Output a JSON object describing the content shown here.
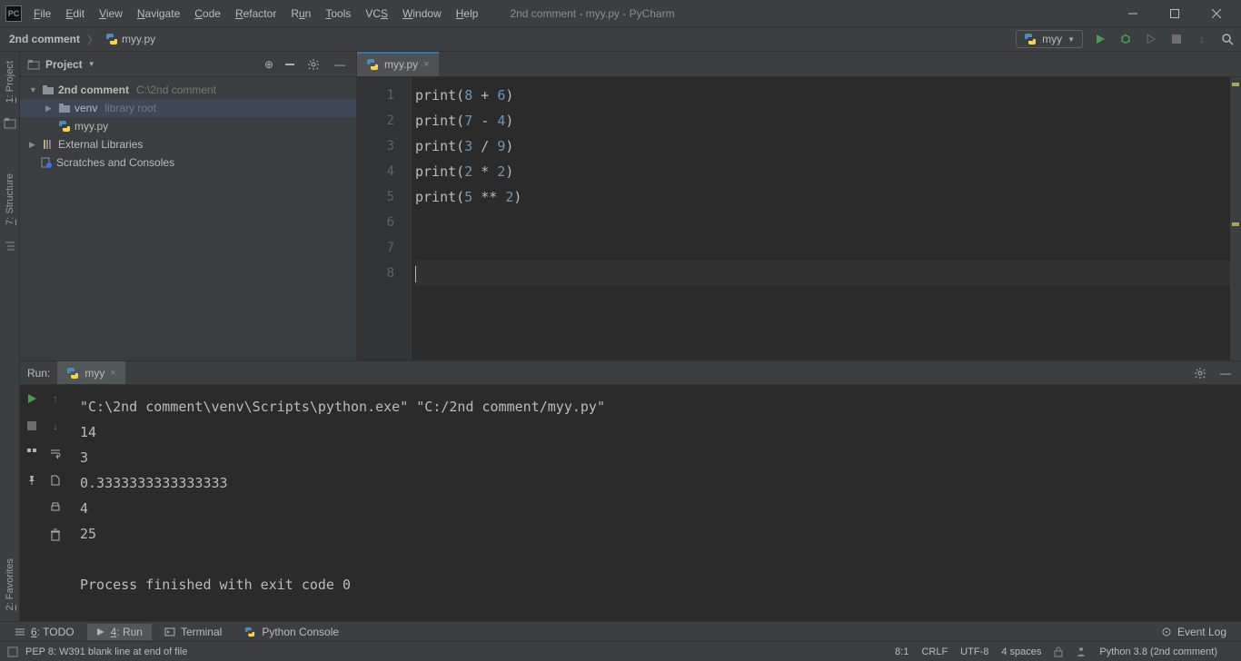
{
  "titlebar": {
    "title": "2nd comment - myy.py - PyCharm"
  },
  "menu": [
    "File",
    "Edit",
    "View",
    "Navigate",
    "Code",
    "Refactor",
    "Run",
    "Tools",
    "VCS",
    "Window",
    "Help"
  ],
  "breadcrumb": {
    "project": "2nd comment",
    "file": "myy.py"
  },
  "run_config": "myy",
  "left_tabs": {
    "project": "1: Project",
    "structure": "7: Structure",
    "favorites": "2: Favorites"
  },
  "project_panel": {
    "title": "Project",
    "tree": {
      "root": "2nd comment",
      "root_path": "C:\\2nd comment",
      "venv": "venv",
      "venv_hint": "library root",
      "file": "myy.py",
      "external": "External Libraries",
      "scratches": "Scratches and Consoles"
    }
  },
  "editor": {
    "tab_file": "myy.py",
    "lines": [
      "print(8 + 6)",
      "print(7 - 4)",
      "print(3 / 9)",
      "print(2 * 2)",
      "print(5 ** 2)",
      "",
      "",
      ""
    ]
  },
  "run_panel": {
    "label": "Run:",
    "tab": "myy",
    "output": [
      "\"C:\\2nd comment\\venv\\Scripts\\python.exe\" \"C:/2nd comment/myy.py\"",
      "14",
      "3",
      "0.3333333333333333",
      "4",
      "25",
      "",
      "Process finished with exit code 0"
    ]
  },
  "bottom_tabs": {
    "todo": "6: TODO",
    "run": "4: Run",
    "terminal": "Terminal",
    "pyconsole": "Python Console",
    "event_log": "Event Log"
  },
  "status": {
    "warning": "PEP 8: W391 blank line at end of file",
    "cursor": "8:1",
    "line_sep": "CRLF",
    "encoding": "UTF-8",
    "indent": "4 spaces",
    "interpreter": "Python 3.8 (2nd comment)"
  }
}
